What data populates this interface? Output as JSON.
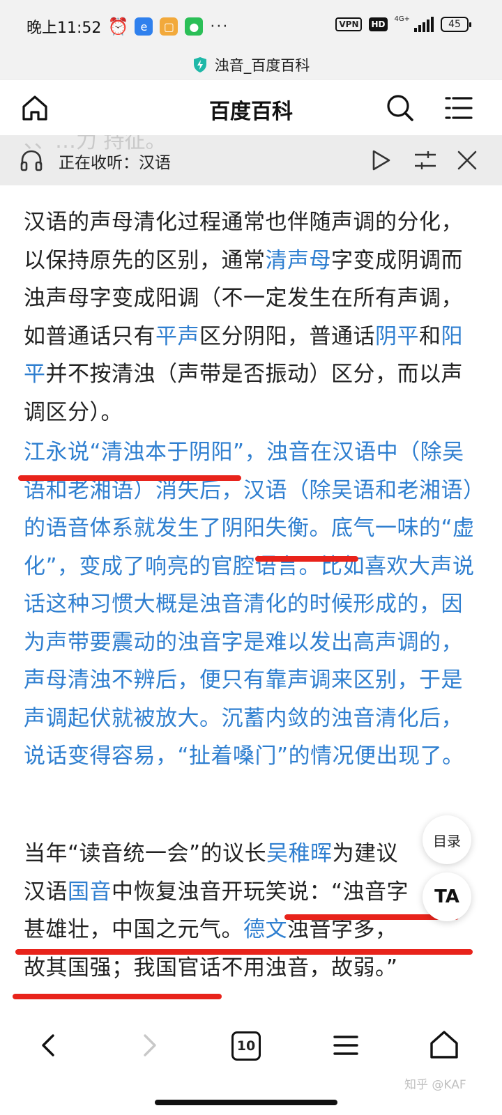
{
  "status_bar": {
    "time": "晚上11:52",
    "dots": "···",
    "vpn": "VPN",
    "hd": "HD",
    "network": "4G+",
    "battery": "45"
  },
  "page": {
    "tab_title": "浊音_百度百科"
  },
  "header": {
    "title": "百度百科"
  },
  "listen": {
    "ghost_text": "、、…力 持征。",
    "label": "正在收听：汉语"
  },
  "article": {
    "p1": {
      "t1": "汉语的声母清化过程通常也伴随声调的分化，以保持原先的区别，通常",
      "l1": "清声母",
      "t2": "字变成阴调而浊声母字变成阳调（不一定发生在所有声调，如普通话只有",
      "l2": "平声",
      "t3": "区分阴阳，普通话",
      "l3": "阴平",
      "t4": "和",
      "l4": "阳平",
      "t5": "并不按清浊（声带是否振动）区分，而以声调区分）。"
    },
    "p2": {
      "text": "江永说“清浊本于阴阳”，浊音在汉语中（除吴语和老湘语）消失后，汉语（除吴语和老湘语）的语音体系就发生了阴阳失衡。底气一味的“虚化”，变成了响亮的官腔语言。比如喜欢大声说话这种习惯大概是浊音清化的时候形成的，因为声带要震动的浊音字是难以发出高声调的，声母清浊不辨后，便只有靠声调来区别，于是声调起伏就被放大。沉蓄内敛的浊音清化后，说话变得容易，“扯着嗓门”的情况便出现了。"
    },
    "p3": {
      "t1": "当年“读音统一会”的议长",
      "l1": "吴稚晖",
      "t2": "为建议汉语",
      "l2": "国音",
      "t3": "中恢复浊音开玩笑说：“浊音字甚雄壮，中国之元气。",
      "l3": "德文",
      "t4": "浊音字多，故其国强；我国官话不用浊音，故弱。”"
    }
  },
  "floating": {
    "toc": "目录",
    "ta": "TA"
  },
  "bottom_nav": {
    "tab_count": "10",
    "watermark": "知乎 @KAF"
  },
  "colors": {
    "link": "#2f7fd0",
    "underline": "#e8231b",
    "bar_bg": "#f2f2f2"
  }
}
